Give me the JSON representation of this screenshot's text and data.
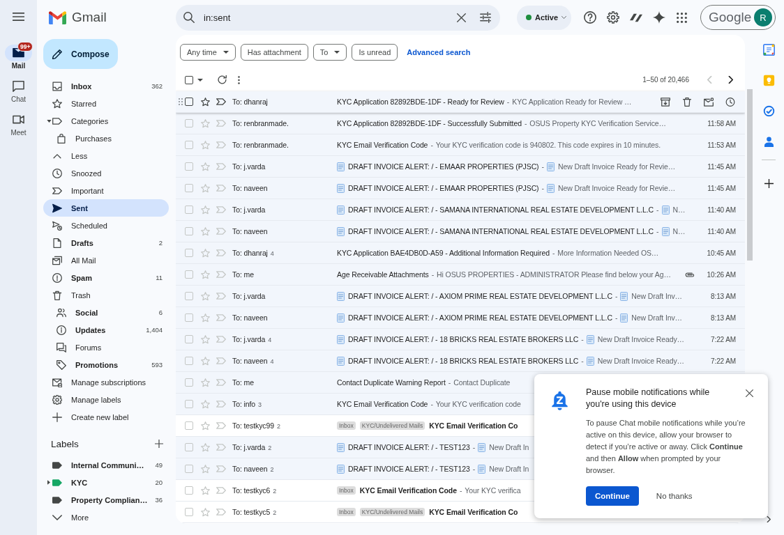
{
  "app": {
    "name": "Gmail"
  },
  "rail": [
    {
      "label": "Mail",
      "selected": true,
      "badge": "99+"
    },
    {
      "label": "Chat",
      "selected": false
    },
    {
      "label": "Meet",
      "selected": false
    }
  ],
  "search": {
    "value": "in:sent"
  },
  "status": {
    "label": "Active"
  },
  "account": {
    "brand": "Google",
    "avatar": "R"
  },
  "compose": {
    "label": "Compose"
  },
  "sidebar": {
    "items": [
      {
        "label": "Inbox",
        "count": "362",
        "unread": true,
        "selected": false,
        "kind": "folder"
      },
      {
        "label": "Starred",
        "unread": false,
        "selected": false,
        "kind": "folder"
      },
      {
        "label": "Categories",
        "unread": false,
        "selected": false,
        "kind": "folder",
        "expanded": true,
        "children": [
          {
            "label": "Purchases",
            "unread": false,
            "selected": false
          }
        ]
      },
      {
        "label": "Less",
        "unread": false,
        "selected": false,
        "kind": "folder"
      },
      {
        "label": "Snoozed",
        "unread": false,
        "selected": false,
        "kind": "folder"
      },
      {
        "label": "Important",
        "unread": false,
        "selected": false,
        "kind": "folder"
      },
      {
        "label": "Sent",
        "unread": false,
        "selected": true,
        "kind": "folder"
      },
      {
        "label": "Scheduled",
        "unread": false,
        "selected": false,
        "kind": "folder"
      },
      {
        "label": "Drafts",
        "count": "2",
        "unread": true,
        "selected": false,
        "kind": "folder"
      },
      {
        "label": "All Mail",
        "unread": false,
        "selected": false,
        "kind": "folder"
      },
      {
        "label": "Spam",
        "count": "11",
        "unread": true,
        "selected": false,
        "kind": "folder"
      },
      {
        "label": "Trash",
        "unread": false,
        "selected": false,
        "kind": "folder"
      },
      {
        "label": "Social",
        "count": "6",
        "unread": true,
        "selected": false,
        "kind": "category"
      },
      {
        "label": "Updates",
        "count": "1,404",
        "unread": true,
        "selected": false,
        "kind": "category"
      },
      {
        "label": "Forums",
        "unread": false,
        "selected": false,
        "kind": "category"
      },
      {
        "label": "Promotions",
        "count": "593",
        "unread": true,
        "selected": false,
        "kind": "category"
      },
      {
        "label": "Manage subscriptions",
        "unread": false,
        "selected": false,
        "kind": "folder"
      },
      {
        "label": "Manage labels",
        "unread": false,
        "selected": false,
        "kind": "folder"
      },
      {
        "label": "Create new label",
        "unread": false,
        "selected": false,
        "kind": "folder"
      }
    ]
  },
  "labels": {
    "title": "Labels",
    "items": [
      {
        "label": "Internal Communi…",
        "count": "49",
        "unread": true,
        "color": "#444746"
      },
      {
        "label": "KYC",
        "count": "20",
        "unread": true,
        "color": "#16a765",
        "expanded": false
      },
      {
        "label": "Property Complian…",
        "count": "36",
        "unread": true,
        "color": "#444746"
      }
    ],
    "more": "More"
  },
  "filters": {
    "chips": [
      {
        "label": "Any time",
        "dropdown": true
      },
      {
        "label": "Has attachment",
        "dropdown": false
      },
      {
        "label": "To",
        "dropdown": true
      },
      {
        "label": "Is unread",
        "dropdown": false
      }
    ],
    "advanced": "Advanced search"
  },
  "toolbar": {
    "select_all": {
      "checked": false
    },
    "range": "1–50 of 20,466",
    "pager": [
      {
        "kind": "prev",
        "disabled": true
      },
      {
        "kind": "next",
        "disabled": false
      }
    ]
  },
  "emails": [
    {
      "recipient": "To: dhanraj",
      "kind": "plain",
      "subject": "KYC Application 82892BDE-1DF - Ready for Review",
      "dash": "-",
      "snippet": "KYC Application Ready for Review …",
      "unread": false,
      "hovered": true,
      "checked": false,
      "starred": false,
      "important": false,
      "attachment": false
    },
    {
      "recipient": "To: renbranmade.",
      "kind": "plain",
      "subject": "KYC Application 82892BDE-1DF - Successfully Submitted",
      "dash": "-",
      "snippet": "OSUS Property KYC Verification Service…",
      "time": "11:58 AM",
      "unread": false,
      "hovered": false,
      "checked": false,
      "starred": false,
      "important": false,
      "attachment": false
    },
    {
      "recipient": "To: renbranmade.",
      "kind": "plain",
      "subject": "KYC Email Verification Code",
      "dash": "-",
      "snippet": "Your KYC verification code is 940802. This code expires in 10 minutes.",
      "time": "11:53 AM",
      "unread": false,
      "hovered": false,
      "checked": false,
      "starred": false,
      "important": false,
      "attachment": false
    },
    {
      "recipient": "To: j.varda",
      "kind": "invoice",
      "subject": "DRAFT INVOICE ALERT: / - EMAAR PROPERTIES (PJSC)",
      "dash": "-",
      "snippet": "New Draft Invoice Ready for Revie…",
      "time": "11:45 AM",
      "unread": false,
      "hovered": false,
      "checked": false,
      "starred": false,
      "important": false,
      "attachment": false
    },
    {
      "recipient": "To: naveen",
      "kind": "invoice",
      "subject": "DRAFT INVOICE ALERT: / - EMAAR PROPERTIES (PJSC)",
      "dash": "-",
      "snippet": "New Draft Invoice Ready for Revie…",
      "time": "11:45 AM",
      "unread": false,
      "hovered": false,
      "checked": false,
      "starred": false,
      "important": false,
      "attachment": false
    },
    {
      "recipient": "To: j.varda",
      "kind": "invoice",
      "subject": "DRAFT INVOICE ALERT: / - SAMANA INTERNATIONAL REAL ESTATE DEVELOPMENT L.L.C",
      "dash": "-",
      "snippet": "N…",
      "time": "11:40 AM",
      "unread": false,
      "hovered": false,
      "checked": false,
      "starred": false,
      "important": false,
      "attachment": false
    },
    {
      "recipient": "To: naveen",
      "kind": "invoice",
      "subject": "DRAFT INVOICE ALERT: / - SAMANA INTERNATIONAL REAL ESTATE DEVELOPMENT L.L.C",
      "dash": "-",
      "snippet": "N…",
      "time": "11:40 AM",
      "unread": false,
      "hovered": false,
      "checked": false,
      "starred": false,
      "important": false,
      "attachment": false
    },
    {
      "recipient": "To: dhanraj",
      "count": "4",
      "kind": "plain",
      "subject": "KYC Application BAE4DB0D-A59 - Additional Information Required",
      "dash": "-",
      "snippet": "More Information Needed OS…",
      "time": "10:45 AM",
      "unread": false,
      "hovered": false,
      "checked": false,
      "starred": false,
      "important": false,
      "attachment": false
    },
    {
      "recipient": "To: me",
      "kind": "plain",
      "subject": "Age Receivable Attachments",
      "dash": "-",
      "snippet": "Hi OSUS PROPERTIES - ADMINISTRATOR Please find below your Ag…",
      "time": "10:26 AM",
      "unread": false,
      "hovered": false,
      "checked": false,
      "starred": false,
      "important": false,
      "attachment": true
    },
    {
      "recipient": "To: j.varda",
      "kind": "invoice",
      "subject": "DRAFT INVOICE ALERT: / - AXIOM PRIME REAL ESTATE DEVELOPMENT L.L.C",
      "dash": "-",
      "snippet": "New Draft Inv…",
      "time": "8:13 AM",
      "unread": false,
      "hovered": false,
      "checked": false,
      "starred": false,
      "important": false,
      "attachment": false
    },
    {
      "recipient": "To: naveen",
      "kind": "invoice",
      "subject": "DRAFT INVOICE ALERT: / - AXIOM PRIME REAL ESTATE DEVELOPMENT L.L.C",
      "dash": "-",
      "snippet": "New Draft Inv…",
      "time": "8:13 AM",
      "unread": false,
      "hovered": false,
      "checked": false,
      "starred": false,
      "important": false,
      "attachment": false
    },
    {
      "recipient": "To: j.varda",
      "count": "4",
      "kind": "invoice",
      "subject": "DRAFT INVOICE ALERT: / - 18 BRICKS REAL ESTATE BROKERS LLC",
      "dash": "-",
      "snippet": "New Draft Invoice Ready…",
      "time": "7:22 AM",
      "unread": false,
      "hovered": false,
      "checked": false,
      "starred": false,
      "important": false,
      "attachment": false
    },
    {
      "recipient": "To: naveen",
      "count": "4",
      "kind": "invoice",
      "subject": "DRAFT INVOICE ALERT: / - 18 BRICKS REAL ESTATE BROKERS LLC",
      "dash": "-",
      "snippet": "New Draft Invoice Ready…",
      "time": "7:22 AM",
      "unread": false,
      "hovered": false,
      "checked": false,
      "starred": false,
      "important": false,
      "attachment": false
    },
    {
      "recipient": "To: me",
      "kind": "plain",
      "subject": "Contact Duplicate Warning Report",
      "dash": "-",
      "snippet": "Contact Duplicate",
      "unread": false,
      "hovered": false,
      "checked": false,
      "starred": false,
      "important": false,
      "attachment": false
    },
    {
      "recipient": "To: info",
      "count": "3",
      "kind": "plain",
      "subject": "KYC Email Verification Code",
      "dash": "-",
      "snippet": "Your KYC verification code",
      "unread": false,
      "hovered": false,
      "checked": false,
      "starred": false,
      "important": false,
      "attachment": false
    },
    {
      "recipient": "To: testkyc99",
      "count": "2",
      "labels": [
        "Inbox",
        "KYC/Undelivered Mails"
      ],
      "kind": "plain",
      "subject": "KYC Email Verification Co",
      "unread": true,
      "hovered": false,
      "checked": false,
      "starred": false,
      "important": false,
      "attachment": false
    },
    {
      "recipient": "To: j.varda",
      "count": "2",
      "kind": "invoice",
      "subject": "DRAFT INVOICE ALERT: / - TEST123",
      "dash": "-",
      "snippet": "New Draft In",
      "unread": false,
      "hovered": false,
      "checked": false,
      "starred": false,
      "important": false,
      "attachment": false
    },
    {
      "recipient": "To: naveen",
      "count": "2",
      "kind": "invoice",
      "subject": "DRAFT INVOICE ALERT: / - TEST123",
      "dash": "-",
      "snippet": "New Draft In",
      "unread": false,
      "hovered": false,
      "checked": false,
      "starred": false,
      "important": false,
      "attachment": false
    },
    {
      "recipient": "To: testkyc6",
      "count": "2",
      "labels": [
        "Inbox"
      ],
      "kind": "plain",
      "subject": "KYC Email Verification Code",
      "dash": "-",
      "snippet": "Your KYC verifica",
      "unread": true,
      "hovered": false,
      "checked": false,
      "starred": false,
      "important": false,
      "attachment": false
    },
    {
      "recipient": "To: testkyc5",
      "count": "2",
      "labels": [
        "Inbox",
        "KYC/Undelivered Mails"
      ],
      "kind": "plain",
      "subject": "KYC Email Verification Co",
      "unread": true,
      "hovered": false,
      "checked": false,
      "starred": false,
      "important": false,
      "attachment": false
    }
  ],
  "popup": {
    "title": "Pause mobile notifications while you're using this device",
    "message": "To pause Chat mobile notifications while you’re active on this device, allow your browser to detect if you’re active or away. Click **Continue** and then **Allow** when prompted by your browser.",
    "buttons": [
      {
        "label": "Continue",
        "kind": "primary"
      },
      {
        "label": "No thanks",
        "kind": "text"
      }
    ]
  }
}
